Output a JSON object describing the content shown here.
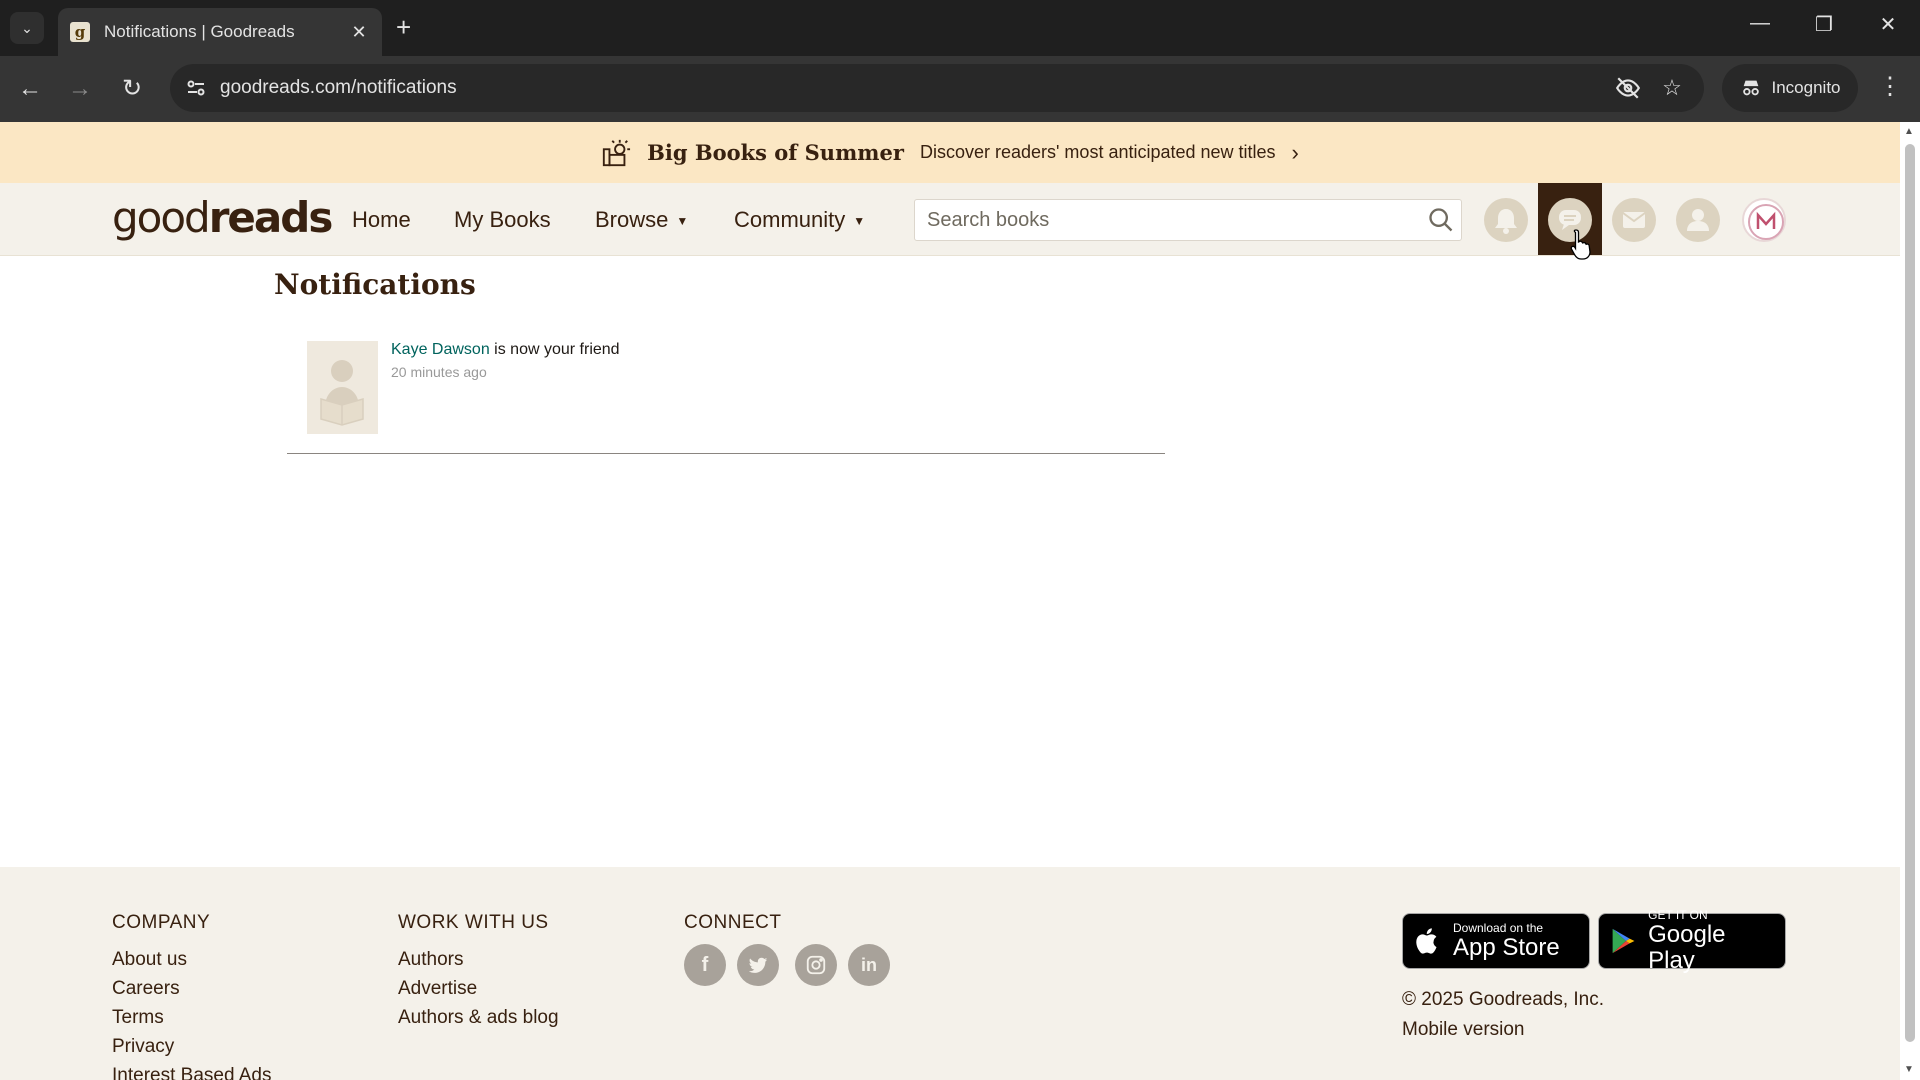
{
  "browser": {
    "tab_title": "Notifications | Goodreads",
    "favicon_letter": "g",
    "url": "goodreads.com/notifications",
    "profile_label": "Incognito"
  },
  "banner": {
    "title": "Big Books of Summer",
    "text": "Discover readers' most anticipated new titles"
  },
  "header": {
    "logo_light": "good",
    "logo_bold": "reads",
    "nav": {
      "home": "Home",
      "my_books": "My Books",
      "browse": "Browse",
      "community": "Community"
    },
    "search_placeholder": "Search books"
  },
  "main": {
    "title": "Notifications",
    "notifications": [
      {
        "name": "Kaye Dawson",
        "text": "is now your friend",
        "time": "20 minutes ago"
      }
    ]
  },
  "footer": {
    "company": {
      "heading": "COMPANY",
      "links": [
        "About us",
        "Careers",
        "Terms",
        "Privacy",
        "Interest Based Ads"
      ]
    },
    "work": {
      "heading": "WORK WITH US",
      "links": [
        "Authors",
        "Advertise",
        "Authors & ads blog"
      ]
    },
    "connect": {
      "heading": "CONNECT",
      "social": [
        "facebook",
        "twitter",
        "instagram",
        "linkedin"
      ]
    },
    "app_store": {
      "small": "Download on the",
      "big": "App Store"
    },
    "google_play": {
      "small": "GET IT ON",
      "big": "Google Play"
    },
    "copyright": "© 2025 Goodreads, Inc.",
    "mobile": "Mobile version"
  },
  "colors": {
    "brand_brown": "#382110",
    "banner_bg": "#fbe7c4",
    "header_bg": "#f4f1ea",
    "link_green": "#00635d"
  }
}
